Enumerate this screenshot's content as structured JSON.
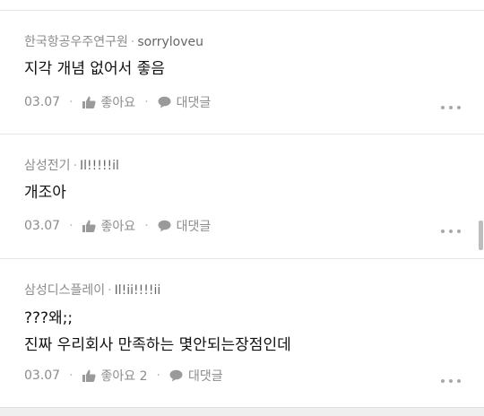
{
  "comments": [
    {
      "company": "한국항공우주연구원",
      "nickname": "sorryloveu",
      "lines": [
        "지각 개념 없어서 좋음"
      ],
      "date": "03.07",
      "like_label": "좋아요",
      "reply_label": "대댓글"
    },
    {
      "company": "삼성전기",
      "nickname": "Il!!!!!il",
      "lines": [
        "개조아"
      ],
      "date": "03.07",
      "like_label": "좋아요",
      "reply_label": "대댓글"
    },
    {
      "company": "삼성디스플레이",
      "nickname": "Il!ii!!!!ii",
      "lines": [
        "???왜;;",
        "진짜 우리회사 만족하는 몇안되는장점인데"
      ],
      "date": "03.07",
      "like_label": "좋아요 2",
      "reply_label": "대댓글"
    }
  ],
  "separator": "·",
  "icons": {
    "like": "thumbs-up-icon",
    "reply": "speech-bubble-icon",
    "more": "more-dots-icon"
  },
  "colors": {
    "meta_text": "#8c8c8c",
    "body_text": "#111111",
    "divider": "#e6e6e6"
  }
}
